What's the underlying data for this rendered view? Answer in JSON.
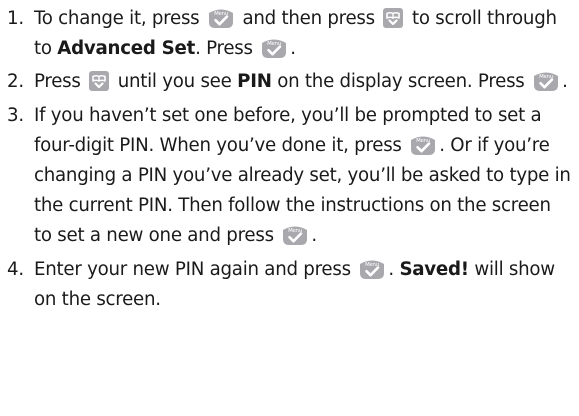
{
  "steps": [
    {
      "number": "1.",
      "parts": [
        {
          "text": "To change it, press "
        },
        {
          "icon": "menu-key-icon"
        },
        {
          "text": " and then press "
        },
        {
          "icon": "scroll-key-icon"
        },
        {
          "text": " to scroll through to "
        },
        {
          "text": "Advanced Set",
          "bold": true
        },
        {
          "text": ". Press "
        },
        {
          "icon": "menu-key-icon"
        },
        {
          "text": "."
        }
      ]
    },
    {
      "number": "2.",
      "parts": [
        {
          "text": "Press "
        },
        {
          "icon": "scroll-key-icon"
        },
        {
          "text": " until you see "
        },
        {
          "text": "PIN",
          "bold": true
        },
        {
          "text": " on the display screen. Press "
        },
        {
          "icon": "menu-key-icon"
        },
        {
          "text": "."
        }
      ]
    },
    {
      "number": "3.",
      "parts": [
        {
          "text": "If you haven’t set one before, you’ll be prompted to set a four-digit PIN. When you’ve done it, press "
        },
        {
          "icon": "menu-key-icon"
        },
        {
          "text": ". Or if you’re changing a PIN you’ve already set, you’ll be asked to type in the current PIN. Then follow the instructions on the screen to set a new one and press "
        },
        {
          "icon": "menu-key-icon"
        },
        {
          "text": "."
        }
      ]
    },
    {
      "number": "4.",
      "parts": [
        {
          "text": "Enter your new PIN again and press "
        },
        {
          "icon": "menu-key-icon"
        },
        {
          "text": ". "
        },
        {
          "text": "Saved!",
          "bold": true
        },
        {
          "text": " will show on the screen."
        }
      ]
    }
  ],
  "icons": {
    "menu-key-icon": {
      "label": "Menu",
      "color": "#a8a8ad",
      "glyph": "checkmark"
    },
    "scroll-key-icon": {
      "label": "",
      "color": "#a8a8ad",
      "glyph": "phonebook-chevron"
    }
  }
}
